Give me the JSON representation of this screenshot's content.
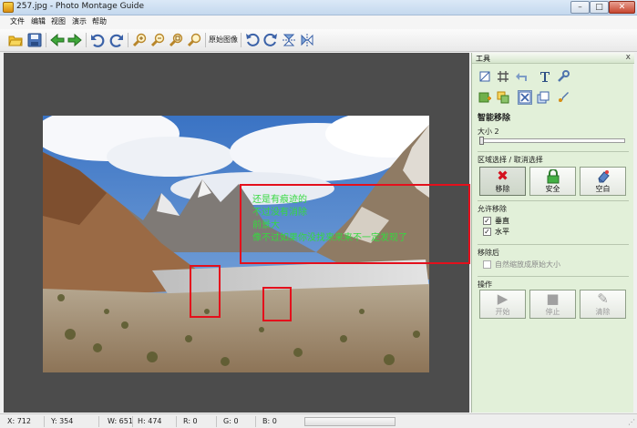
{
  "window": {
    "title": "257.jpg - Photo Montage Guide",
    "controls": [
      "–",
      "□",
      "✕"
    ]
  },
  "menu": [
    "文件",
    "编辑",
    "视图",
    "演示",
    "帮助"
  ],
  "toolbar": {
    "buttons": [
      "open-icon",
      "save-icon",
      "back-arrow-icon",
      "forward-arrow-icon",
      "undo-icon",
      "redo-icon",
      "zoom-in-icon",
      "zoom-out-icon",
      "zoom-fit-icon",
      "zoom-actual-icon",
      "rotate-left-icon",
      "rotate-right-icon",
      "flip-vertical-icon",
      "flip-horizontal-icon"
    ],
    "original_image_label": "原始图像"
  },
  "overlay": {
    "lines": [
      "还是有痕迹的",
      "不过没有消除",
      "前景大",
      "像不过如果你没找来来来不一定发现了"
    ],
    "text_color": "#35d93f",
    "box_color": "#e4101c"
  },
  "panel": {
    "title": "工具",
    "close": "x",
    "mode_title": "智能移除",
    "size_label": "大小 2",
    "size_value": 2,
    "region_label": "区域选择 / 取消选择",
    "region_buttons": [
      "移除",
      "安全",
      "空白"
    ],
    "allow_label": "允许移除",
    "allow_options": [
      {
        "label": "垂直",
        "checked": true
      },
      {
        "label": "水平",
        "checked": true
      }
    ],
    "after_label": "移除后",
    "after_option": {
      "label": "自然缩放成原始大小",
      "checked": false
    },
    "ops_label": "操作",
    "ops_buttons": [
      "开始",
      "停止",
      "清除"
    ]
  },
  "status": {
    "x": "X: 712",
    "y": "Y: 354",
    "w": "W: 651",
    "h": "H: 474",
    "r": "R: 0",
    "g": "G: 0",
    "b": "B: 0"
  },
  "colors": {
    "canvas_bg": "#4c4c4c",
    "panel_bg": "#e2f0d9",
    "accent_red": "#e4101c"
  }
}
